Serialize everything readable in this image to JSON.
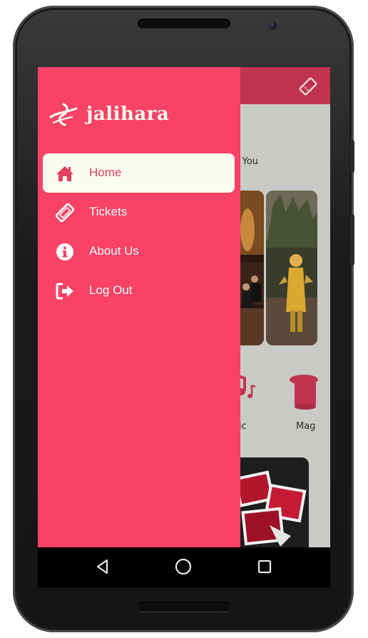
{
  "app": {
    "brand_name": "jalihara",
    "colors": {
      "drawer": "#f84266",
      "app_bar": "#c0344f",
      "active_bg": "#fbfcf0",
      "active_text": "#e23e5d"
    }
  },
  "background": {
    "section_label": "r You",
    "categories": [
      {
        "label": "ic",
        "icon": "music-notes-icon"
      },
      {
        "label": "Mag",
        "icon": "magic-hat-icon"
      }
    ]
  },
  "drawer": {
    "items": [
      {
        "label": "Home",
        "icon": "home-icon",
        "active": true
      },
      {
        "label": "Tickets",
        "icon": "ticket-icon",
        "active": false
      },
      {
        "label": "About Us",
        "icon": "info-icon",
        "active": false
      },
      {
        "label": "Log Out",
        "icon": "logout-icon",
        "active": false
      }
    ]
  },
  "navbar": {
    "buttons": [
      "back-icon",
      "home-circle-icon",
      "recents-icon"
    ]
  }
}
